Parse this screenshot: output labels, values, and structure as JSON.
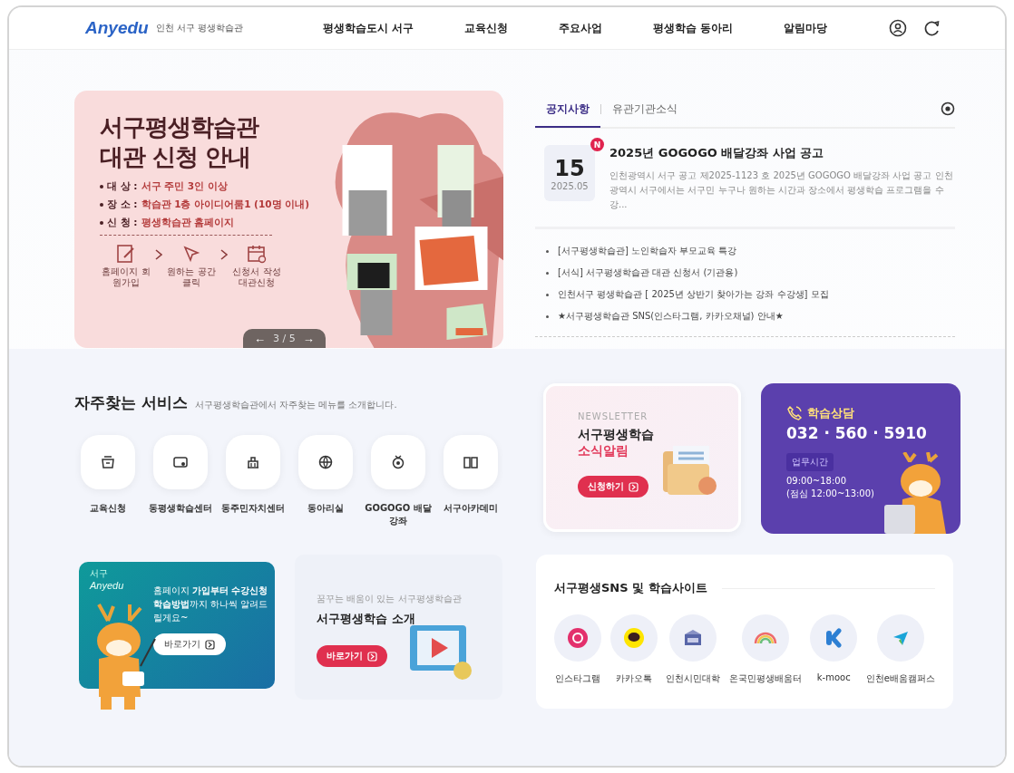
{
  "header": {
    "logo": "Anyedu",
    "site_name": "인천 서구 평생학습관",
    "nav": [
      "평생학습도시 서구",
      "교육신청",
      "주요사업",
      "평생학습 동아리",
      "알림마당"
    ]
  },
  "banner": {
    "title_lines": [
      "서구평생학습관",
      "대관 신청 안내"
    ],
    "details": [
      {
        "label": "대 상 :",
        "value": "서구 주민 3인 이상"
      },
      {
        "label": "장 소 :",
        "value": "학습관 1층 아이디어룸1 (10명 이내)"
      },
      {
        "label": "신 청 :",
        "value": "평생학습관 홈페이지"
      }
    ],
    "steps": [
      "홈페이지 회원가입",
      "원하는 공간 클릭",
      "신청서 작성 대관신청"
    ],
    "pager": {
      "prev": "←",
      "current": "3",
      "separator": "/",
      "total": "5",
      "next": "→"
    }
  },
  "notices": {
    "tabs": [
      {
        "label": "공지사항",
        "selected": true
      },
      {
        "label": "유관기관소식",
        "selected": false
      }
    ],
    "featured": {
      "day": "15",
      "date": "2025.05",
      "badge": "N",
      "title": "2025년 GOGOGO 배달강좌 사업 공고",
      "summary": "인천광역시 서구 공고 제2025-1123 호 2025년 GOGOGO 배달강좌 사업 공고 인천광역시 서구에서는 서구민 누구나 원하는 시간과 장소에서 평생학습 프로그램을 수강..."
    },
    "items": [
      "[서구평생학습관] 노인학습자 부모교육 특강",
      "[서식] 서구평생학습관 대관 신청서 (기관용)",
      "인천서구 평생학습관 [ 2025년 상반기 찾아가는 강좌 수강생] 모집",
      "★서구평생학습관 SNS(인스타그램, 카카오채널) 안내★"
    ]
  },
  "services": {
    "title": "자주찾는 서비스",
    "subtitle": "서구평생학습관에서 자주찾는 메뉴를 소개합니다.",
    "items": [
      "교육신청",
      "동평생학습센터",
      "동주민자치센터",
      "동아리실",
      "GOGOGO 배달강좌",
      "서구아카데미"
    ]
  },
  "newsletter": {
    "eyebrow": "NEWSLETTER",
    "title": "서구평생학습",
    "highlight": "소식알림",
    "button": "신청하기"
  },
  "consult": {
    "title": "학습상담",
    "phone": "032 · 560 · 5910",
    "hours_badge": "업무시간",
    "hours": "09:00~18:00",
    "lunch": "(점심 12:00~13:00)"
  },
  "guide": {
    "logo_small": "서구",
    "logo": "Anyedu",
    "text": "홈페이지 **가입부터** **수강신청 학습방법**까지 하나씩 알려드릴게요~",
    "button": "바로가기"
  },
  "intro": {
    "eyebrow": "꿈꾸는 배움이 있는 서구평생학습관",
    "title": "서구평생학습 **소개**",
    "button": "바로가기"
  },
  "sns": {
    "title": "**서구평생SNS** 및 학습사이트",
    "items": [
      "인스타그램",
      "카카오톡",
      "인천시민대학",
      "온국민평생배움터",
      "k-mooc",
      "인천e배움캠퍼스"
    ]
  }
}
